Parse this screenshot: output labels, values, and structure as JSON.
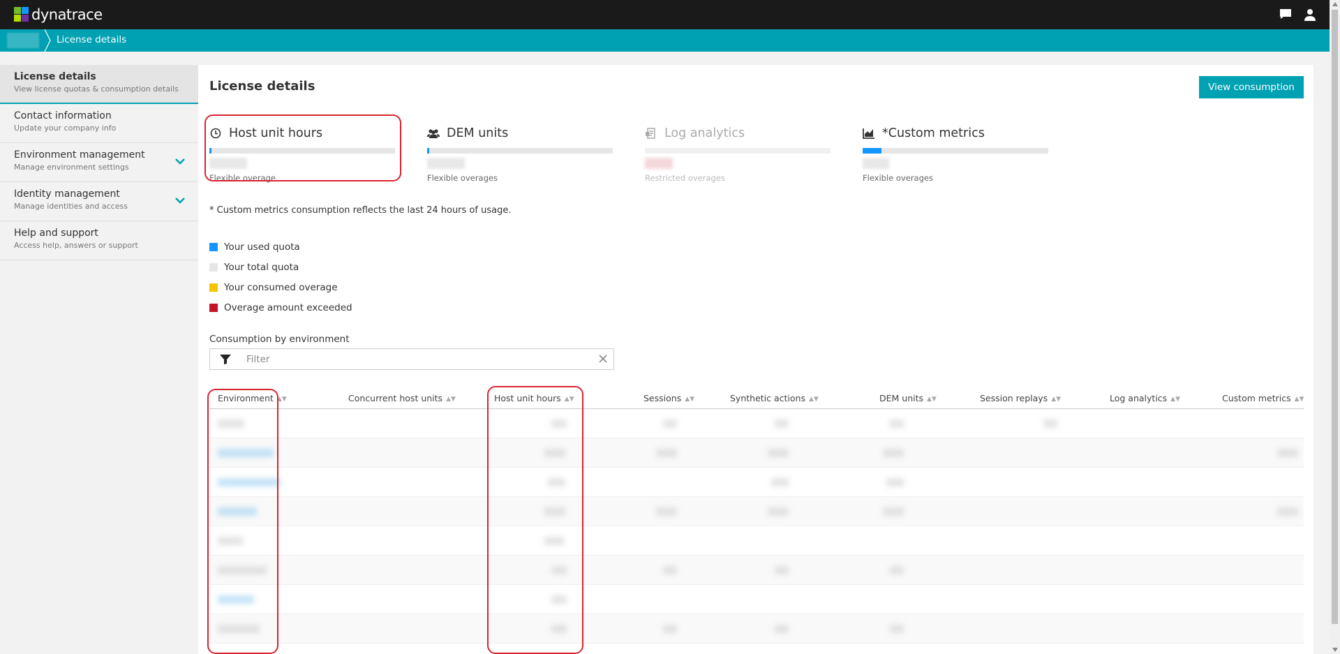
{
  "app": {
    "logo_text": "dynatrace"
  },
  "breadcrumb": {
    "current": "License details"
  },
  "sidebar": {
    "items": [
      {
        "title": "License details",
        "subtitle": "View license quotas & consumption details"
      },
      {
        "title": "Contact information",
        "subtitle": "Update your company info"
      },
      {
        "title": "Environment management",
        "subtitle": "Manage environment settings"
      },
      {
        "title": "Identity management",
        "subtitle": "Manage identities and access"
      },
      {
        "title": "Help and support",
        "subtitle": "Access help, answers or support"
      }
    ]
  },
  "main": {
    "title": "License details",
    "view_consumption_label": "View consumption",
    "tiles": [
      {
        "title": "Host unit hours",
        "note": "Flexible overage",
        "icon": "clock-icon",
        "used_fraction": 0.01
      },
      {
        "title": "DEM units",
        "note": "Flexible overages",
        "icon": "users-icon",
        "used_fraction": 0.01
      },
      {
        "title": "Log analytics",
        "note": "Restricted overages",
        "icon": "log-icon",
        "used_fraction": 0
      },
      {
        "title": "*Custom metrics",
        "note": "Flexible overages",
        "icon": "area-chart-icon",
        "used_fraction": 0.1
      }
    ],
    "footnote": "* Custom metrics consumption reflects the last 24 hours of usage.",
    "legend": [
      {
        "label": "Your used quota",
        "color": "#1496ff"
      },
      {
        "label": "Your total quota",
        "color": "#e6e6e6"
      },
      {
        "label": "Your consumed overage",
        "color": "#f5c400"
      },
      {
        "label": "Overage amount exceeded",
        "color": "#c41425"
      }
    ],
    "consumption_label": "Consumption by environment",
    "filter_placeholder": "Filter",
    "table": {
      "columns": [
        "Environment",
        "Concurrent host units",
        "Host unit hours",
        "Sessions",
        "Synthetic actions",
        "DEM units",
        "Session replays",
        "Log analytics",
        "Custom metrics"
      ]
    }
  },
  "colors": {
    "accent": "#00a1b2",
    "topbar": "#1a1a1a",
    "highlight": "#d9232f"
  }
}
